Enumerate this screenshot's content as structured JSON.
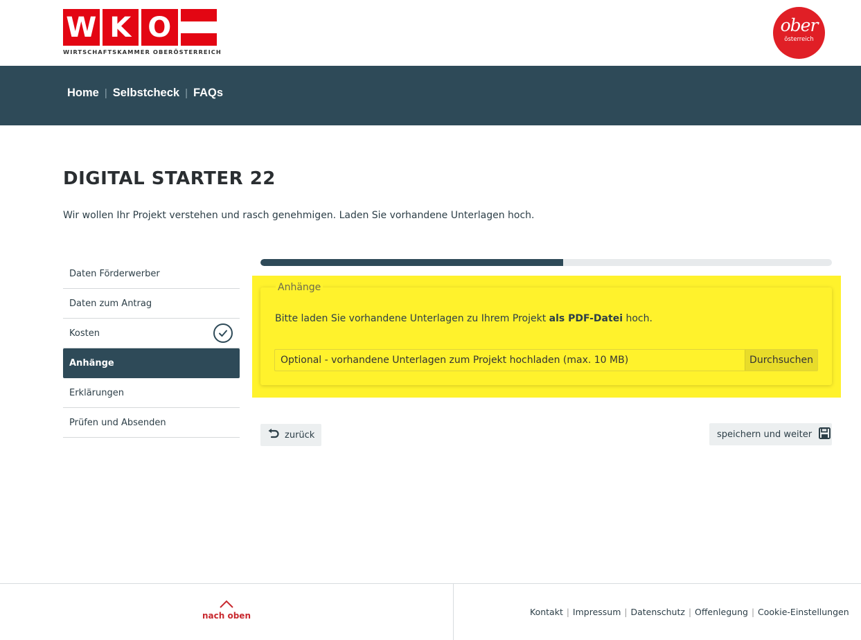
{
  "header": {
    "wko_letters": [
      "W",
      "K",
      "O"
    ],
    "wko_tagline": "WIRTSCHAFTSKAMMER OBERÖSTERREICH",
    "ober_main": "ober",
    "ober_sub": "österreich"
  },
  "nav": {
    "items": [
      "Home",
      "Selbstcheck",
      "FAQs"
    ],
    "separator": "|"
  },
  "page": {
    "title": "DIGITAL STARTER 22",
    "intro": "Wir wollen Ihr Projekt verstehen und rasch genehmigen. Laden Sie vorhandene Unterlagen hoch."
  },
  "steps": [
    {
      "label": "Daten Förderwerber",
      "done": false,
      "active": false
    },
    {
      "label": "Daten zum Antrag",
      "done": false,
      "active": false
    },
    {
      "label": "Kosten",
      "done": true,
      "active": false
    },
    {
      "label": "Anhänge",
      "done": false,
      "active": true
    },
    {
      "label": "Erklärungen",
      "done": false,
      "active": false
    },
    {
      "label": "Prüfen und Absenden",
      "done": false,
      "active": false
    }
  ],
  "progress": {
    "percent": 53
  },
  "attachments": {
    "legend": "Anhänge",
    "text_before": "Bitte laden Sie vorhandene Unterlagen zu Ihrem Projekt ",
    "text_bold": "als PDF-Datei",
    "text_after": " hoch.",
    "file_placeholder": "Optional - vorhandene Unterlagen zum Projekt hochladen (max. 10 MB)",
    "browse_label": "Durchsuchen",
    "highlight_color": "#fff22c"
  },
  "actions": {
    "back_label": "zurück",
    "save_label": "speichern und weiter"
  },
  "footer": {
    "to_top_label": "nach oben",
    "links": [
      "Kontakt",
      "Impressum",
      "Datenschutz",
      "Offenlegung",
      "Cookie-Einstellungen"
    ],
    "separator": "|"
  },
  "colors": {
    "brand_red": "#e30613",
    "nav_dark": "#2e4a58",
    "highlight_yellow": "#fff22c"
  }
}
